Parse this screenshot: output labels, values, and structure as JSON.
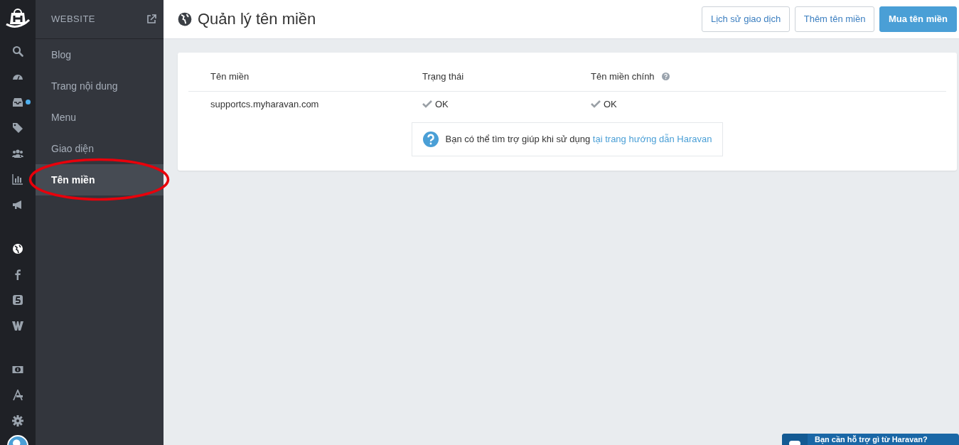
{
  "rail": [
    {
      "selected": false,
      "badge": false
    },
    {
      "selected": false,
      "badge": false
    },
    {
      "selected": false,
      "badge": true
    },
    {
      "selected": false,
      "badge": false
    },
    {
      "selected": false,
      "badge": false
    },
    {
      "selected": false,
      "badge": false
    },
    {
      "selected": false,
      "badge": false
    },
    {
      "selected": true,
      "badge": false
    },
    {
      "selected": false,
      "badge": false
    },
    {
      "selected": false,
      "badge": false
    },
    {
      "selected": false,
      "badge": false
    },
    {
      "selected": false,
      "badge": false
    },
    {
      "selected": false,
      "badge": false
    },
    {
      "selected": false,
      "badge": false
    }
  ],
  "sidebar": {
    "title": "WEBSITE",
    "items": [
      {
        "label": "Blog",
        "selected": false
      },
      {
        "label": "Trang nội dung",
        "selected": false
      },
      {
        "label": "Menu",
        "selected": false
      },
      {
        "label": "Giao diện",
        "selected": false
      },
      {
        "label": "Tên miền",
        "selected": true
      }
    ]
  },
  "page": {
    "title": "Quản lý tên miền",
    "buttons": [
      {
        "label": "Lịch sử giao dịch",
        "kind": "outline"
      },
      {
        "label": "Thêm tên miền",
        "kind": "outline"
      },
      {
        "label": "Mua tên miền",
        "kind": "primary"
      }
    ]
  },
  "table": {
    "columns": [
      {
        "label": "Tên miền",
        "help": false
      },
      {
        "label": "Trạng thái",
        "help": false
      },
      {
        "label": "Tên miền chính",
        "help": true
      }
    ],
    "rows": [
      {
        "domain": "supportcs.myharavan.com",
        "status": "OK",
        "primary": "OK"
      }
    ]
  },
  "help_note": {
    "text": "Bạn có thể tìm trợ giúp khi sử dụng",
    "link": "tại trang hướng dẫn Haravan"
  },
  "chat": {
    "text": "Bạn cần hỗ trợ gì từ Haravan?"
  }
}
